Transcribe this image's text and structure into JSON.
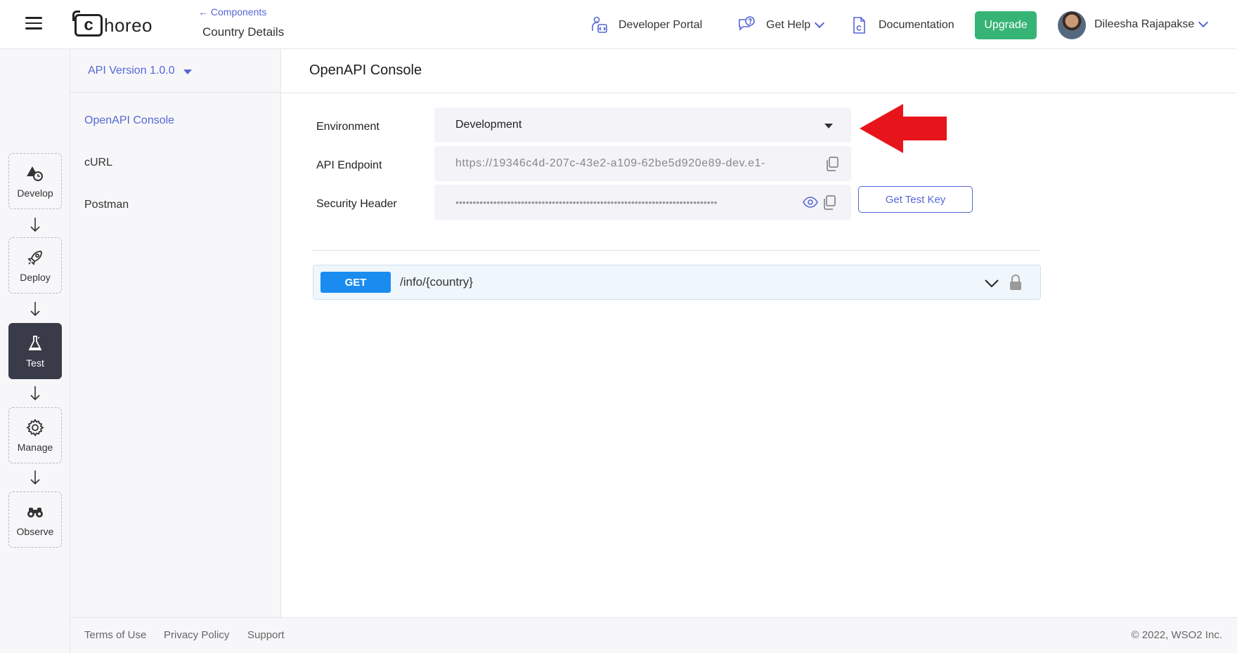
{
  "header": {
    "logo_text": "horeo",
    "logo_letter": "c",
    "breadcrumb_back": "← Components",
    "breadcrumb_title": "Country Details",
    "developer_portal": "Developer Portal",
    "get_help": "Get Help",
    "documentation": "Documentation",
    "upgrade": "Upgrade",
    "user_name": "Dileesha Rajapakse"
  },
  "rail": {
    "steps": [
      {
        "label": "Develop",
        "icon": "develop-icon"
      },
      {
        "label": "Deploy",
        "icon": "rocket-icon"
      },
      {
        "label": "Test",
        "icon": "flask-icon",
        "active": true
      },
      {
        "label": "Manage",
        "icon": "gear-icon"
      },
      {
        "label": "Observe",
        "icon": "binoculars-icon"
      }
    ]
  },
  "subnav": {
    "api_version": "API Version 1.0.0",
    "items": [
      {
        "label": "OpenAPI Console",
        "active": true
      },
      {
        "label": "cURL"
      },
      {
        "label": "Postman"
      }
    ]
  },
  "main": {
    "title": "OpenAPI Console",
    "environment_label": "Environment",
    "environment_value": "Development",
    "endpoint_label": "API Endpoint",
    "endpoint_value": "https://19346c4d-207c-43e2-a109-62be5d920e89-dev.e1-",
    "security_label": "Security Header",
    "security_value": "••••••••••••••••••••••••••••••••••••••••••••••••••••••••••••••••••••••••••••",
    "get_test_key": "Get Test Key",
    "operation": {
      "method": "GET",
      "path": "/info/{country}"
    }
  },
  "footer": {
    "terms": "Terms of Use",
    "privacy": "Privacy Policy",
    "support": "Support",
    "copyright": "©  2022, WSO2 Inc."
  },
  "colors": {
    "accent": "#5567d5",
    "upgrade": "#36b475",
    "get_badge": "#1a8cf0",
    "annotation_arrow": "#e8141c"
  }
}
